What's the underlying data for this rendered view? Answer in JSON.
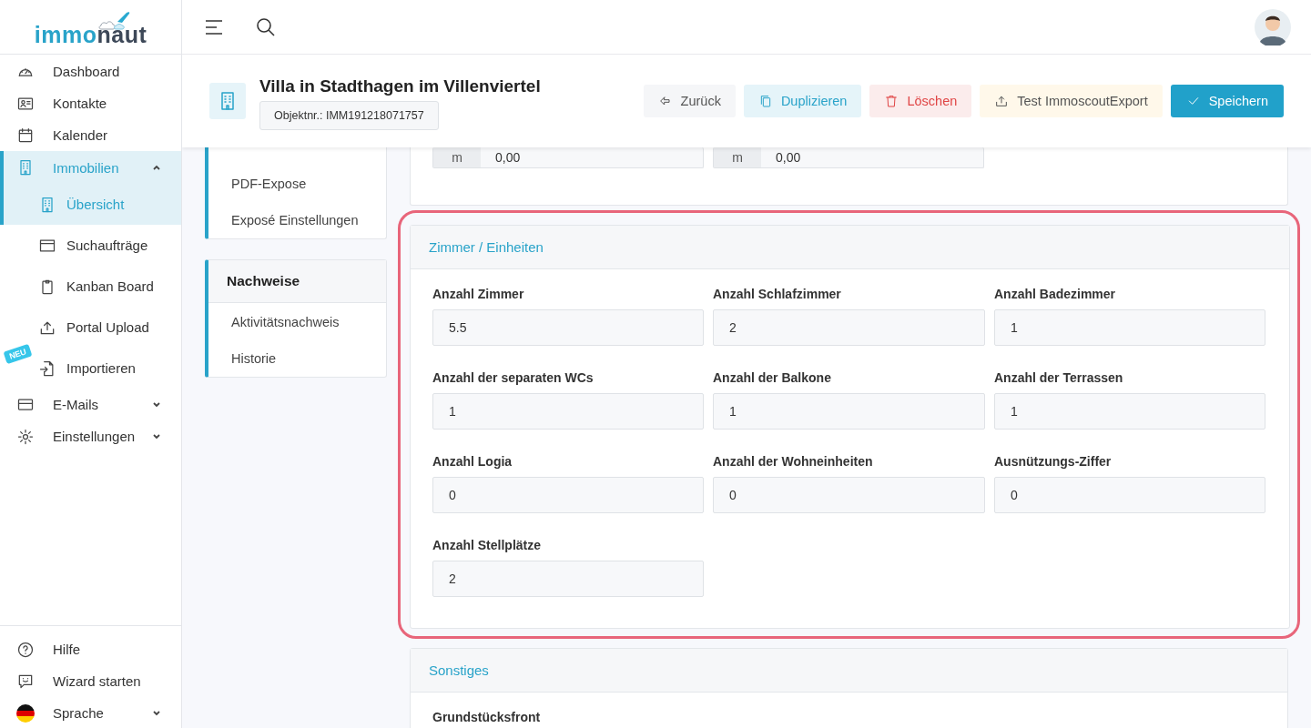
{
  "logo": {
    "part_1": "immo",
    "part_2": "naut"
  },
  "sidebar": {
    "items": [
      {
        "label": "Dashboard",
        "selected": false
      },
      {
        "label": "Kontakte",
        "selected": false
      },
      {
        "label": "Kalender",
        "selected": false
      },
      {
        "label": "Immobilien",
        "selected": true,
        "expanded": true,
        "children": [
          {
            "label": "Übersicht",
            "selected": true
          },
          {
            "label": "Suchaufträge",
            "selected": false
          },
          {
            "label": "Kanban Board",
            "selected": false
          },
          {
            "label": "Portal Upload",
            "selected": false
          },
          {
            "label": "Importieren",
            "selected": false,
            "badge": "NEU"
          }
        ]
      },
      {
        "label": "E-Mails",
        "selected": false,
        "expanded": false
      },
      {
        "label": "Einstellungen",
        "selected": false,
        "expanded": false
      }
    ],
    "footer_items": [
      {
        "label": "Hilfe"
      },
      {
        "label": "Wizard starten"
      },
      {
        "label": "Sprache",
        "expanded": false
      }
    ]
  },
  "header": {
    "title": "Villa in Stadthagen im Villenviertel",
    "object_number": "Objektnr.: IMM191218071757",
    "buttons": [
      {
        "label": "Zurück",
        "kind": "back"
      },
      {
        "label": "Duplizieren",
        "kind": "duplicate"
      },
      {
        "label": "Löschen",
        "kind": "delete"
      },
      {
        "label": "Test ImmoscoutExport",
        "kind": "export"
      },
      {
        "label": "Speichern",
        "kind": "save"
      }
    ]
  },
  "side_nav": [
    {
      "items": [
        "PDF-Expose",
        "Exposé Einstellungen"
      ]
    },
    {
      "title": "Nachweise",
      "items": [
        "Aktivitätsnachweis",
        "Historie"
      ]
    }
  ],
  "sections": [
    {
      "highlighted": false,
      "fields": [
        {
          "addon": "m",
          "value": "0,00"
        },
        {
          "addon": "m",
          "value": "0,00"
        }
      ]
    },
    {
      "title": "Zimmer / Einheiten",
      "highlighted": true,
      "fields": [
        {
          "label": "Anzahl Zimmer",
          "value": "5.5"
        },
        {
          "label": "Anzahl Schlafzimmer",
          "value": "2"
        },
        {
          "label": "Anzahl Badezimmer",
          "value": "1"
        },
        {
          "label": "Anzahl der separaten WCs",
          "value": "1"
        },
        {
          "label": "Anzahl der Balkone",
          "value": "1"
        },
        {
          "label": "Anzahl der Terrassen",
          "value": "1"
        },
        {
          "label": "Anzahl Logia",
          "value": "0"
        },
        {
          "label": "Anzahl der Wohneinheiten",
          "value": "0"
        },
        {
          "label": "Ausnützungs-Ziffer",
          "value": "0"
        },
        {
          "label": "Anzahl Stellplätze",
          "value": "2"
        }
      ]
    },
    {
      "title": "Sonstiges",
      "highlighted": false,
      "fields": [
        {
          "label": "Grundstücksfront"
        }
      ]
    }
  ]
}
